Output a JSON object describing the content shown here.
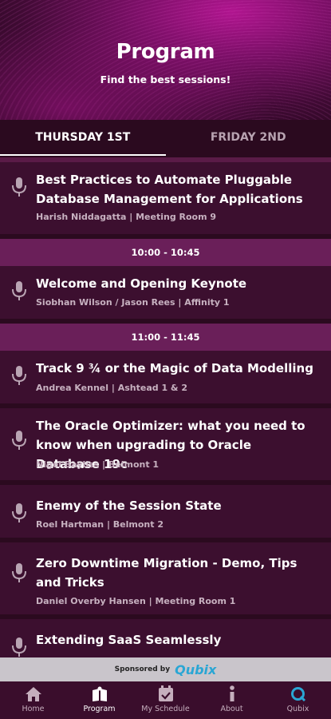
{
  "header": {
    "title": "Program",
    "subtitle": "Find the best sessions!"
  },
  "tabs": [
    {
      "label": "THURSDAY 1ST",
      "active": true
    },
    {
      "label": "FRIDAY 2ND",
      "active": false
    }
  ],
  "sessions_before": [
    {
      "title": "Best Practices to Automate Pluggable Database Management for Applications",
      "meta": "Harish Niddagatta | Meeting Room 9"
    }
  ],
  "slots": [
    {
      "time": "10:00 - 10:45",
      "sessions": [
        {
          "title": "Welcome and Opening Keynote",
          "meta": "Siobhan Wilson / Jason Rees | Affinity 1"
        }
      ]
    },
    {
      "time": "11:00 - 11:45",
      "sessions": [
        {
          "title": "Track 9 ¾ or the Magic of Data Modelling",
          "meta": "Andrea Kennel | Ashtead 1 & 2"
        },
        {
          "title": "The Oracle Optimizer: what you need to know when upgrading to Oracle Database 19c",
          "meta": "Nigel Bayliss | Belmont 1"
        },
        {
          "title": "Enemy of the Session State",
          "meta": "Roel Hartman | Belmont 2"
        },
        {
          "title": "Zero Downtime Migration - Demo, Tips and Tricks",
          "meta": "Daniel Overby Hansen | Meeting Room 1"
        },
        {
          "title": "Extending SaaS Seamlessly",
          "meta": ""
        }
      ]
    }
  ],
  "sponsor": {
    "label": "Sponsored by",
    "brand": "Qubix"
  },
  "nav": [
    {
      "label": "Home",
      "icon": "home-icon",
      "active": false
    },
    {
      "label": "Program",
      "icon": "program-icon",
      "active": true
    },
    {
      "label": "My Schedule",
      "icon": "calendar-icon",
      "active": false
    },
    {
      "label": "About",
      "icon": "info-icon",
      "active": false
    },
    {
      "label": "Qubix",
      "icon": "qubix-icon",
      "active": false
    }
  ],
  "colors": {
    "background": "#2b0a1f",
    "card": "#3c0f2f",
    "slot_bar": "#6a1f59",
    "header_accent": "#b0158f",
    "sponsor_brand": "#2aa6d4"
  }
}
